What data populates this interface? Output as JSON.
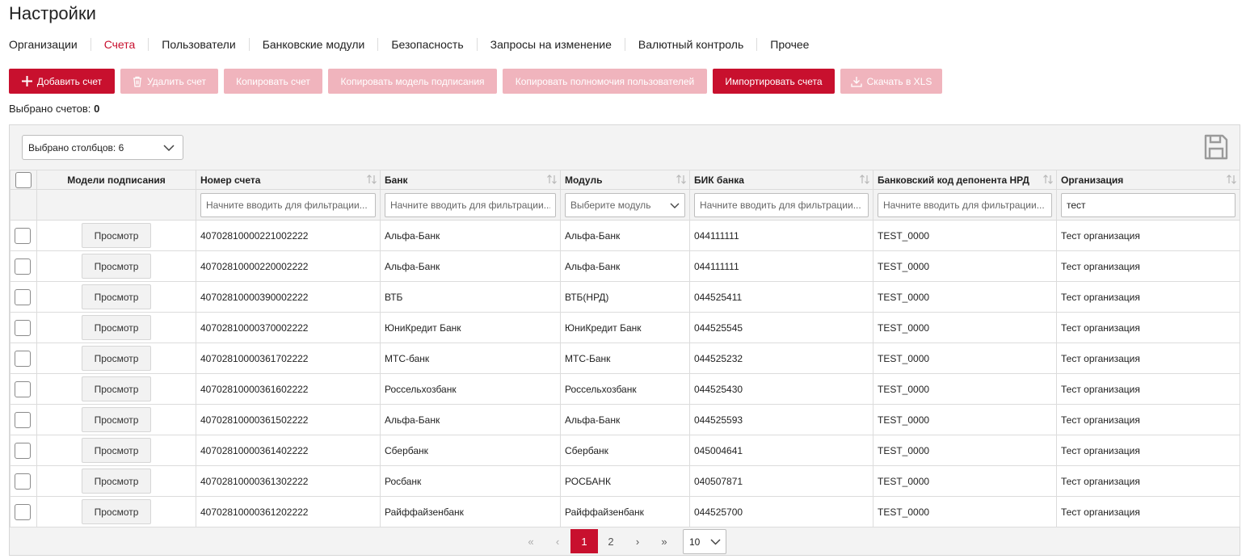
{
  "page": {
    "title": "Настройки"
  },
  "tabs": [
    {
      "label": "Организации",
      "active": false
    },
    {
      "label": "Счета",
      "active": true
    },
    {
      "label": "Пользователи",
      "active": false
    },
    {
      "label": "Банковские модули",
      "active": false
    },
    {
      "label": "Безопасность",
      "active": false
    },
    {
      "label": "Запросы на изменение",
      "active": false
    },
    {
      "label": "Валютный контроль",
      "active": false
    },
    {
      "label": "Прочее",
      "active": false
    }
  ],
  "toolbar": {
    "add": "Добавить счет",
    "delete": "Удалить счет",
    "copy": "Копировать счет",
    "copy_model": "Копировать модель подписания",
    "copy_perms": "Копировать полномочия пользователей",
    "import": "Импортировать счета",
    "download": "Скачать в XLS"
  },
  "selected": {
    "label": "Выбрано счетов:",
    "count": "0"
  },
  "columns_select": "Выбрано столбцов: 6",
  "headers": {
    "models": "Модели подписания",
    "account": "Номер счета",
    "bank": "Банк",
    "module": "Модуль",
    "bik": "БИК банка",
    "nrd": "Банковский код депонента НРД",
    "org": "Организация"
  },
  "filters": {
    "placeholder": "Начните вводить для фильтрации...",
    "module_placeholder": "Выберите модуль",
    "org_value": "тест"
  },
  "view_label": "Просмотр",
  "rows": [
    {
      "account": "40702810000221002222",
      "bank": "Альфа-Банк",
      "module": "Альфа-Банк",
      "bik": "044111111",
      "nrd": "TEST_0000",
      "org": "Тест организация"
    },
    {
      "account": "40702810000220002222",
      "bank": "Альфа-Банк",
      "module": "Альфа-Банк",
      "bik": "044111111",
      "nrd": "TEST_0000",
      "org": "Тест организация"
    },
    {
      "account": "40702810000390002222",
      "bank": "ВТБ",
      "module": "ВТБ(НРД)",
      "bik": "044525411",
      "nrd": "TEST_0000",
      "org": "Тест организация"
    },
    {
      "account": "40702810000370002222",
      "bank": "ЮниКредит Банк",
      "module": "ЮниКредит Банк",
      "bik": "044525545",
      "nrd": "TEST_0000",
      "org": "Тест организация"
    },
    {
      "account": "40702810000361702222",
      "bank": "МТС-банк",
      "module": "МТС-Банк",
      "bik": "044525232",
      "nrd": "TEST_0000",
      "org": "Тест организация"
    },
    {
      "account": "40702810000361602222",
      "bank": "Россельхозбанк",
      "module": "Россельхозбанк",
      "bik": "044525430",
      "nrd": "TEST_0000",
      "org": "Тест организация"
    },
    {
      "account": "40702810000361502222",
      "bank": "Альфа-Банк",
      "module": "Альфа-Банк",
      "bik": "044525593",
      "nrd": "TEST_0000",
      "org": "Тест организация"
    },
    {
      "account": "40702810000361402222",
      "bank": "Сбербанк",
      "module": "Сбербанк",
      "bik": "045004641",
      "nrd": "TEST_0000",
      "org": "Тест организация"
    },
    {
      "account": "40702810000361302222",
      "bank": "Росбанк",
      "module": "РОСБАНК",
      "bik": "040507871",
      "nrd": "TEST_0000",
      "org": "Тест организация"
    },
    {
      "account": "40702810000361202222",
      "bank": "Райффайзенбанк",
      "module": "Райффайзенбанк",
      "bik": "044525700",
      "nrd": "TEST_0000",
      "org": "Тест организация"
    }
  ],
  "pagination": {
    "first": "«",
    "prev": "‹",
    "pages": [
      "1",
      "2"
    ],
    "next": "›",
    "last": "»",
    "page_size": "10"
  },
  "colors": {
    "accent": "#c8102e",
    "accent_disabled": "#f0b4bd"
  }
}
